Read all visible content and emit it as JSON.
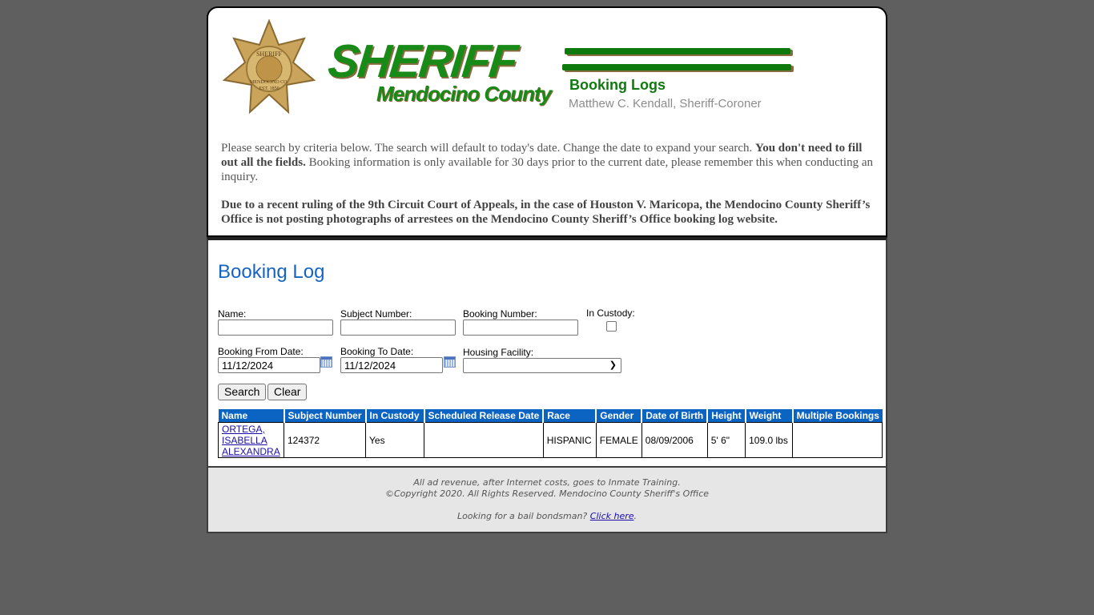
{
  "header": {
    "badge_text": [
      "SHERIFF",
      "MENDOCINO CO.",
      "EST. 1850"
    ],
    "logo_title": "SHERIFF",
    "logo_subtitle": "Mendocino County",
    "section_title": "Booking Logs",
    "sheriff_name": "Matthew C. Kendall, Sheriff-Coroner",
    "intro_p1_a": "Please search by criteria below. The search will default to today's date. Change the date to expand your search. ",
    "intro_p1_bold": "You don't need to fill out all the fields.",
    "intro_p1_b": " Booking information is only available for 30 days prior to the current date, please remember this when conducting an inquiry.",
    "intro_p2": "Due to a recent ruling of the 9th Circuit Court of Appeals, in the case of Houston V. Maricopa, the Mendocino County Sheriff’s Office is not posting photographs of arrestees on the Mendocino County Sheriff’s Office booking log website."
  },
  "main": {
    "title": "Booking Log",
    "form": {
      "name_label": "Name:",
      "name_value": "",
      "subject_label": "Subject Number:",
      "subject_value": "",
      "booking_label": "Booking Number:",
      "booking_value": "",
      "custody_label": "In Custody:",
      "custody_checked": false,
      "from_label": "Booking From Date:",
      "from_value": "11/12/2024",
      "to_label": "Booking To Date:",
      "to_value": "11/12/2024",
      "facility_label": "Housing Facility:",
      "facility_value": "",
      "search_button": "Search",
      "clear_button": "Clear"
    },
    "table": {
      "headers": [
        "Name",
        "Subject Number",
        "In Custody",
        "Scheduled Release Date",
        "Race",
        "Gender",
        "Date of Birth",
        "Height",
        "Weight",
        "Multiple Bookings"
      ],
      "rows": [
        {
          "name_lines": [
            "ORTEGA,",
            "ISABELLA",
            "ALEXANDRA"
          ],
          "subject_number": "124372",
          "in_custody": "Yes",
          "release_date": "",
          "race": "HISPANIC",
          "gender": "FEMALE",
          "dob": "08/09/2006",
          "height": "5' 6\"",
          "weight": "109.0 lbs",
          "multiple_bookings": ""
        }
      ]
    }
  },
  "footer": {
    "line1": "All ad revenue, after Internet costs, goes to Inmate Training.",
    "line2": "©Copyright 2020. All Rights Reserved. Mendocino County Sheriff's Office",
    "bondsman_text": "Looking for a bail bondsman? ",
    "bondsman_link": "Click here",
    "bondsman_end": "."
  },
  "colors": {
    "background": "#5f5f5f",
    "brand_green": "#178a17",
    "title_blue": "#1565c0",
    "table_header": "#0c64c2",
    "footer_bg": "#e6e6e6"
  }
}
